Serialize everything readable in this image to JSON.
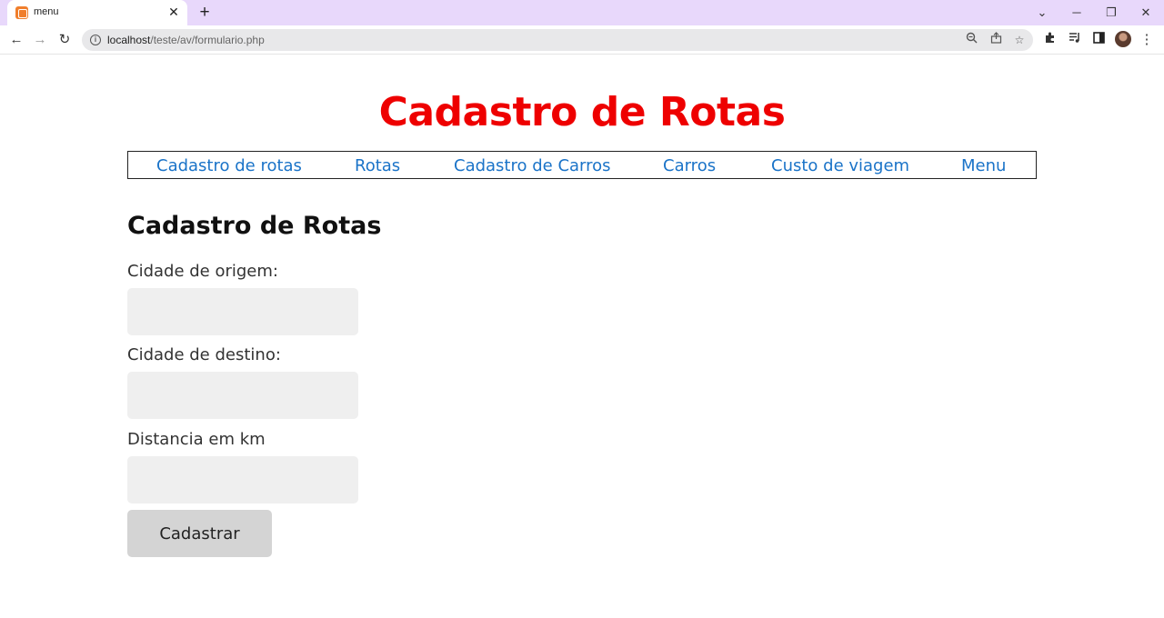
{
  "browser": {
    "tab_title": "menu",
    "tab_close": "✕",
    "new_tab": "+",
    "url_host": "localhost",
    "url_path": "/teste/av/formulario.php",
    "window_controls": {
      "dropdown": "⌄",
      "minimize": "─",
      "restore": "❐",
      "close": "✕"
    },
    "nav": {
      "back": "←",
      "forward": "→",
      "reload": "↻"
    },
    "icons": [
      "zoom-icon",
      "share-icon",
      "bookmark-star-icon",
      "extensions-icon",
      "media-icon",
      "side-panel-icon",
      "profile-avatar",
      "menu-kebab-icon"
    ]
  },
  "page": {
    "title": "Cadastro de Rotas",
    "nav_links": [
      "Cadastro de rotas",
      "Rotas",
      "Cadastro de Carros",
      "Carros",
      "Custo de viagem",
      "Menu"
    ],
    "form": {
      "heading": "Cadastro de Rotas",
      "fields": [
        {
          "label": "Cidade de origem:",
          "value": ""
        },
        {
          "label": "Cidade de destino:",
          "value": ""
        },
        {
          "label": "Distancia em km",
          "value": ""
        }
      ],
      "submit_label": "Cadastrar"
    }
  },
  "colors": {
    "title": "#ee0000",
    "link": "#1a73c8",
    "tabstrip": "#e8d8fb",
    "input_bg": "#efefef",
    "button_bg": "#d4d4d4"
  }
}
